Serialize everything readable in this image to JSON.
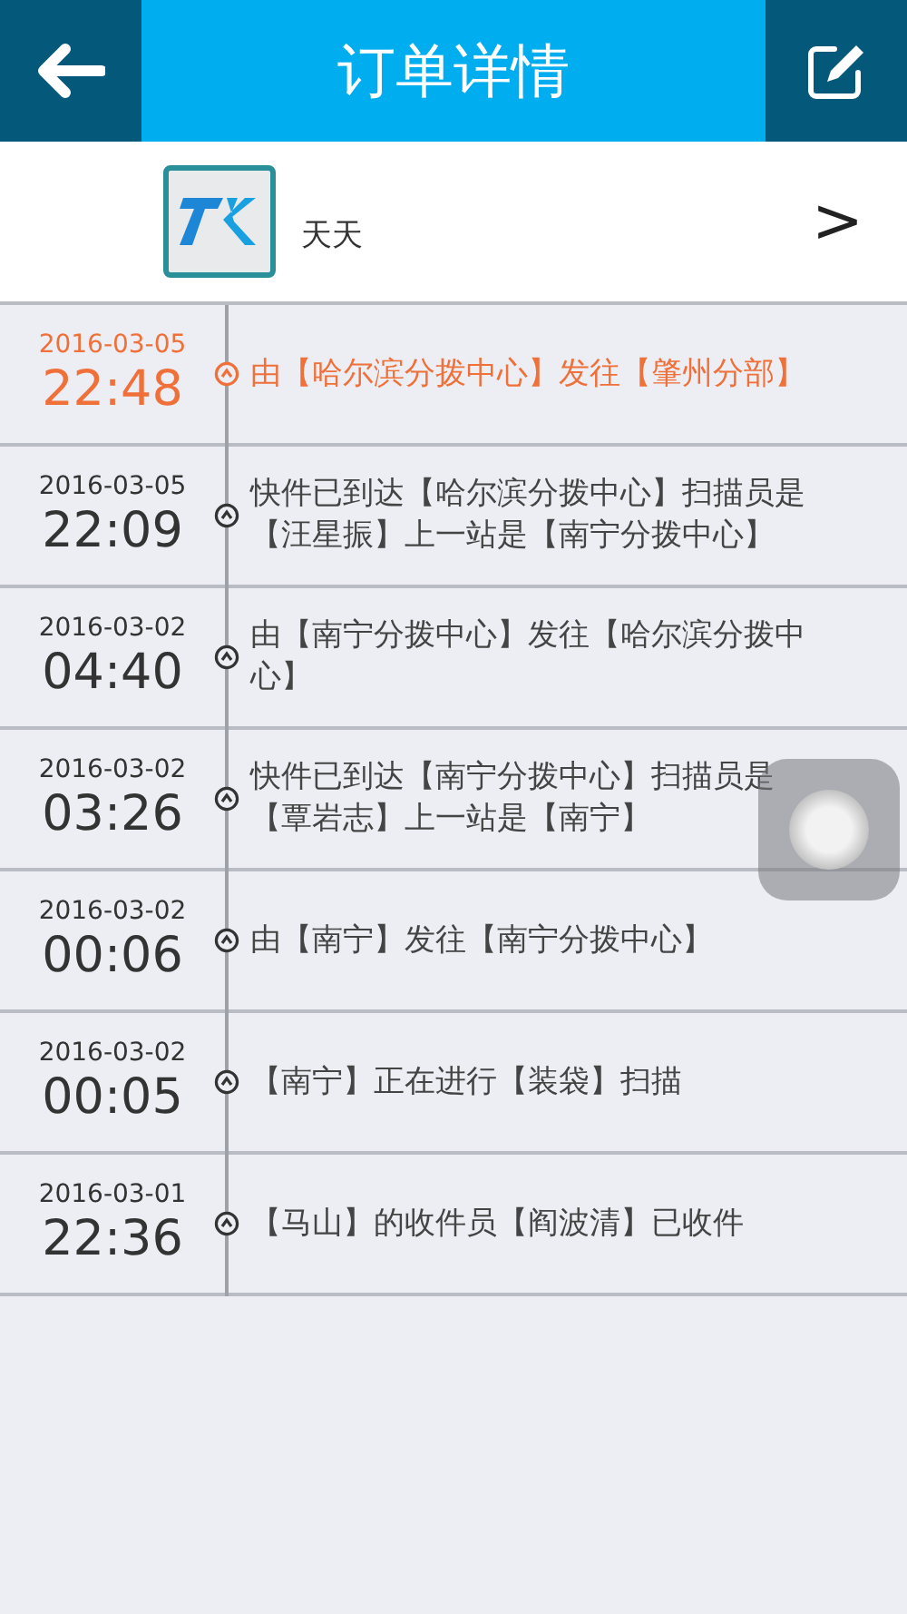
{
  "header": {
    "title": "订单详情"
  },
  "company": {
    "name": "天天",
    "arrow": ">"
  },
  "events": [
    {
      "date": "2016-03-05",
      "time": "22:48",
      "text": "由【哈尔滨分拨中心】发往【肇州分部】",
      "latest": true
    },
    {
      "date": "2016-03-05",
      "time": "22:09",
      "text": "快件已到达【哈尔滨分拨中心】扫描员是【汪星振】上一站是【南宁分拨中心】",
      "latest": false
    },
    {
      "date": "2016-03-02",
      "time": "04:40",
      "text": "由【南宁分拨中心】发往【哈尔滨分拨中心】",
      "latest": false
    },
    {
      "date": "2016-03-02",
      "time": "03:26",
      "text": "快件已到达【南宁分拨中心】扫描员是【覃岩志】上一站是【南宁】",
      "latest": false
    },
    {
      "date": "2016-03-02",
      "time": "00:06",
      "text": "由【南宁】发往【南宁分拨中心】",
      "latest": false
    },
    {
      "date": "2016-03-02",
      "time": "00:05",
      "text": "【南宁】正在进行【装袋】扫描",
      "latest": false
    },
    {
      "date": "2016-03-01",
      "time": "22:36",
      "text": "【马山】的收件员【阎波清】已收件",
      "latest": false
    }
  ]
}
